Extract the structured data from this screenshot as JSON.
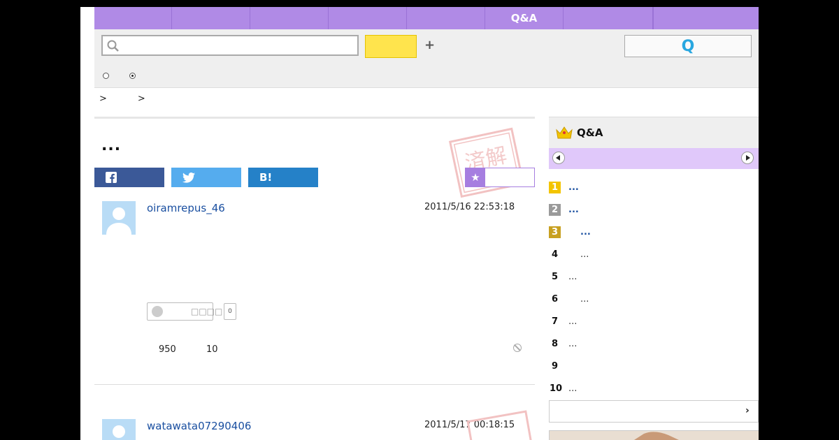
{
  "nav": {
    "items": [
      "",
      "",
      "",
      "",
      "",
      "Q&A",
      "",
      ""
    ]
  },
  "search": {
    "placeholder": "",
    "plus_label": "+",
    "submit_label": "Q"
  },
  "breadcrumb": {
    "sep1": ">",
    "sep2": ">"
  },
  "question": {
    "title": "...",
    "share": {
      "facebook": "f",
      "twitter": "t",
      "hatena": "B!"
    },
    "favorite_icon": "★",
    "stamp_text": "済解"
  },
  "answers": [
    {
      "username": "oiramrepus_46",
      "date": "2011/5/16  22:53:18",
      "reaction_label": "□□□□",
      "reaction_count": "0",
      "stat1": "950",
      "stat2": "10"
    },
    {
      "username": "watawata07290406",
      "date": "2011/5/17  00:18:15"
    }
  ],
  "sidebar": {
    "title": "Q&A",
    "more_label": "›",
    "ranking": [
      {
        "num": "1",
        "text": "...",
        "style": "gold"
      },
      {
        "num": "2",
        "text": "...",
        "style": "silver"
      },
      {
        "num": "3",
        "text": "...",
        "style": "bronze"
      },
      {
        "num": "4",
        "text": "...",
        "style": "plain"
      },
      {
        "num": "5",
        "text": "...",
        "style": "plain"
      },
      {
        "num": "6",
        "text": "...",
        "style": "plain"
      },
      {
        "num": "7",
        "text": "...",
        "style": "plain"
      },
      {
        "num": "8",
        "text": "...",
        "style": "plain"
      },
      {
        "num": "9",
        "text": "",
        "style": "plain"
      },
      {
        "num": "10",
        "text": "...",
        "style": "plain"
      }
    ]
  },
  "colors": {
    "nav": "#b08ae6",
    "accent_yellow": "#ffe44d",
    "link": "#1a4fa0"
  }
}
